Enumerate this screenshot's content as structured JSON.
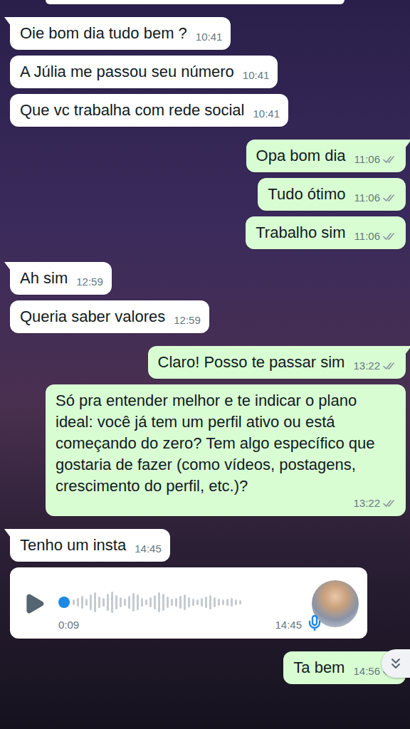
{
  "chat": {
    "messages": [
      {
        "kind": "text",
        "direction": "in",
        "text": "Oie bom dia tudo bem ?",
        "time": "10:41"
      },
      {
        "kind": "text",
        "direction": "in",
        "text": "A Júlia me passou seu número",
        "time": "10:41"
      },
      {
        "kind": "text",
        "direction": "in",
        "text": "Que vc trabalha com rede social",
        "time": "10:41"
      },
      {
        "kind": "text",
        "direction": "out",
        "text": "Opa bom dia",
        "time": "11:06",
        "ticks": true
      },
      {
        "kind": "text",
        "direction": "out",
        "text": "Tudo ótimo",
        "time": "11:06",
        "ticks": true
      },
      {
        "kind": "text",
        "direction": "out",
        "text": "Trabalho sim",
        "time": "11:06",
        "ticks": true
      },
      {
        "kind": "text",
        "direction": "in",
        "text": "Ah sim",
        "time": "12:59"
      },
      {
        "kind": "text",
        "direction": "in",
        "text": "Queria saber valores",
        "time": "12:59"
      },
      {
        "kind": "text",
        "direction": "out",
        "text": "Claro! Posso te passar sim",
        "time": "13:22",
        "ticks": true
      },
      {
        "kind": "text",
        "direction": "out",
        "text": "Só pra entender melhor e te indicar o plano ideal: você já tem um perfil ativo ou está começando do zero? Tem algo específico que gostaria de fazer (como vídeos, postagens, crescimento do perfil, etc.)?",
        "time": "13:22",
        "ticks": true
      },
      {
        "kind": "text",
        "direction": "in",
        "text": "Tenho um insta",
        "time": "14:45"
      },
      {
        "kind": "voice",
        "direction": "in",
        "duration": "0:09",
        "time": "14:45",
        "level": 0
      },
      {
        "kind": "text",
        "direction": "out",
        "text": "Ta bem",
        "time": "14:56",
        "ticks": true
      }
    ]
  }
}
